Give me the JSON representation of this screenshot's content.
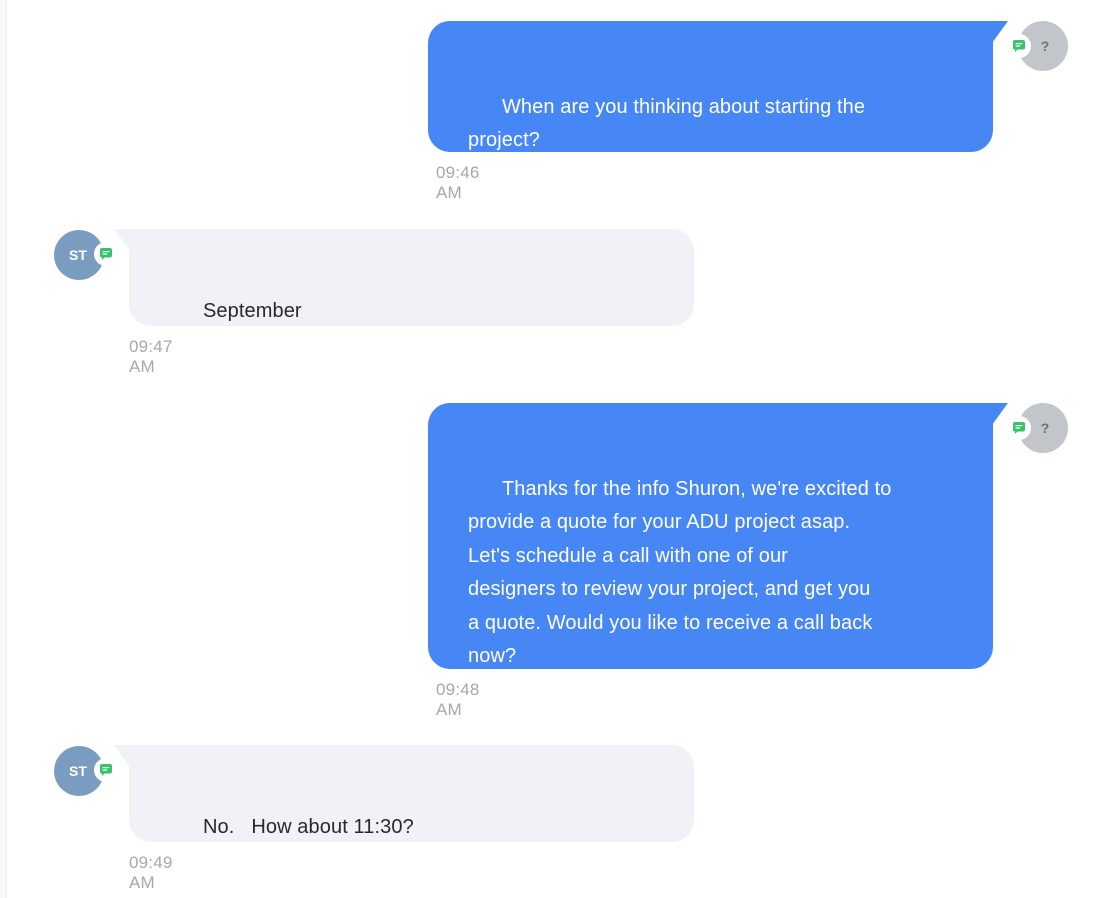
{
  "colors": {
    "outgoing_bubble": "#4786f5",
    "incoming_bubble": "#f0f2f7",
    "incoming_text": "#27292e",
    "timestamp": "#a4a8b0",
    "sender_avatar": "#c2c5ca",
    "contact_avatar": "#7b9cc1",
    "sms_badge": "#37c36a"
  },
  "icons": {
    "channel": "sms-chat-icon"
  },
  "avatars": {
    "sender_initials": "?",
    "contact_initials": "ST"
  },
  "messages": [
    {
      "direction": "outgoing",
      "text": "When are you thinking about starting the\nproject?",
      "time": "09:46 AM"
    },
    {
      "direction": "incoming",
      "text": "September",
      "time": "09:47 AM"
    },
    {
      "direction": "outgoing",
      "text": "Thanks for the info Shuron, we're excited to\nprovide a quote for your ADU project asap.\nLet's schedule a call with one of our\ndesigners to review your project, and get you\na quote. Would you like to receive a call back\nnow?",
      "time": "09:48 AM"
    },
    {
      "direction": "incoming",
      "text": "No.   How about 11:30?",
      "time": "09:49 AM"
    }
  ]
}
